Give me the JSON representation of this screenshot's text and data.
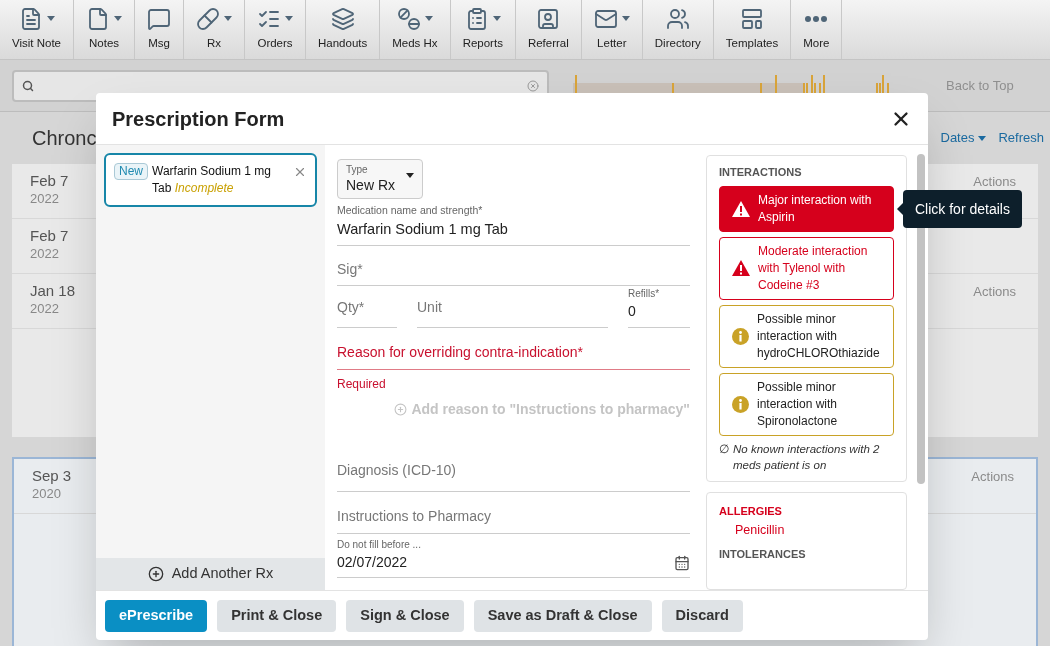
{
  "toolbar": [
    {
      "label": "Visit Note",
      "dropdown": true
    },
    {
      "label": "Notes",
      "dropdown": true
    },
    {
      "label": "Msg",
      "dropdown": false
    },
    {
      "label": "Rx",
      "dropdown": true
    },
    {
      "label": "Orders",
      "dropdown": true
    },
    {
      "label": "Handouts",
      "dropdown": false
    },
    {
      "label": "Meds Hx",
      "dropdown": true
    },
    {
      "label": "Reports",
      "dropdown": true
    },
    {
      "label": "Referral",
      "dropdown": false
    },
    {
      "label": "Letter",
      "dropdown": true
    },
    {
      "label": "Directory",
      "dropdown": false
    },
    {
      "label": "Templates",
      "dropdown": false
    },
    {
      "label": "More",
      "dropdown": false
    }
  ],
  "back_to_top": "Back to Top",
  "background": {
    "heading": "Chronc",
    "dates_menu": "Dates",
    "refresh": "Refresh",
    "cards": [
      {
        "highlighted": false,
        "entries": [
          {
            "date": "Feb 7",
            "year": "2022",
            "actions": "Actions"
          },
          {
            "date": "Feb 7",
            "year": "2022"
          },
          {
            "date": "Jan 18",
            "year": "2022",
            "actions": "Actions"
          }
        ]
      },
      {
        "highlighted": true,
        "entries": [
          {
            "date": "Sep 3",
            "year": "2020",
            "actions": "Actions"
          }
        ]
      }
    ]
  },
  "modal": {
    "title": "Prescription Form",
    "rx_list": [
      {
        "badge": "New",
        "name": "Warfarin Sodium 1 mg Tab *Incomplete*",
        "selected": true
      }
    ],
    "add_another": "Add Another Rx",
    "form": {
      "type_label": "Type",
      "type_value": "New Rx",
      "medication_label": "Medication name and strength*",
      "medication_value": "Warfarin Sodium 1 mg Tab",
      "sig_placeholder": "Sig*",
      "qty_placeholder": "Qty*",
      "unit_placeholder": "Unit",
      "refills_label": "Refills*",
      "refills_value": "0",
      "reason_placeholder": "Reason for overriding contra-indication*",
      "reason_error": "Required",
      "add_reason_link": "Add reason to \"Instructions to pharmacy\"",
      "diagnosis_placeholder": "Diagnosis (ICD-10)",
      "instructions_placeholder": "Instructions to Pharmacy",
      "fill_date_label": "Do not fill before ...",
      "fill_date_value": "02/07/2022"
    },
    "interactions": {
      "title": "INTERACTIONS",
      "items": [
        {
          "kind": "major",
          "text": "Major interaction with Aspirin"
        },
        {
          "kind": "moderate",
          "text": "Moderate interaction with Tylenol with Codeine #3"
        },
        {
          "kind": "minor",
          "text": "Possible minor interaction with hydroCHLOROthiazide"
        },
        {
          "kind": "minor",
          "text": "Possible minor interaction with Spironolactone"
        }
      ],
      "note_icon": "∅",
      "note": "No known interactions with 2 meds patient is on"
    },
    "allergies": {
      "title": "ALLERGIES",
      "items": [
        "Penicillin"
      ],
      "intolerances_title": "INTOLERANCES"
    },
    "tooltip": "Click for details",
    "buttons": [
      {
        "label": "ePrescribe",
        "primary": true
      },
      {
        "label": "Print & Close",
        "primary": false
      },
      {
        "label": "Sign & Close",
        "primary": false
      },
      {
        "label": "Save as Draft & Close",
        "primary": false
      },
      {
        "label": "Discard",
        "primary": false
      }
    ]
  }
}
